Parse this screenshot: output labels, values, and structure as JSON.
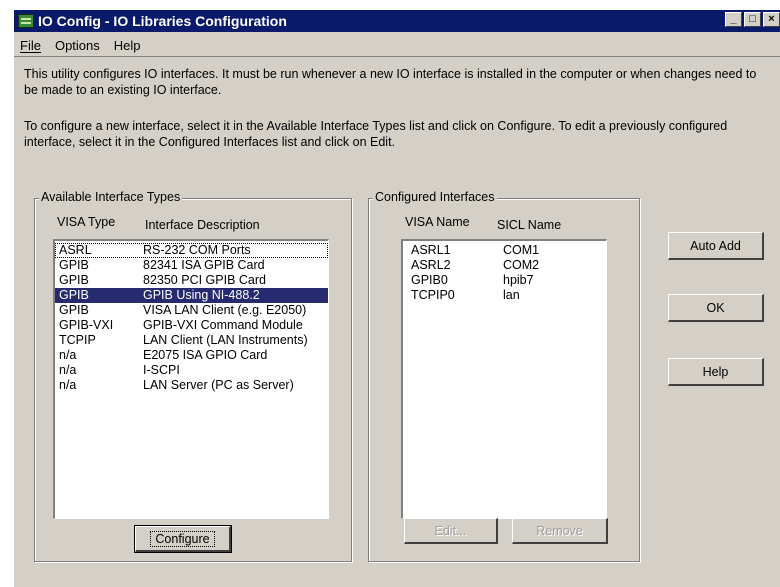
{
  "window": {
    "title": "IO Config - IO Libraries Configuration",
    "controls": [
      "_",
      "□",
      "×"
    ]
  },
  "menu": [
    {
      "label": "File",
      "mnemonic": "F"
    },
    {
      "label": "Options",
      "mnemonic": "O"
    },
    {
      "label": "Help",
      "mnemonic": "H"
    }
  ],
  "intro": {
    "line1": "This utility configures IO interfaces.  It must be run whenever a new IO interface is installed in the computer or when changes need to be made to an existing IO interface.",
    "line2": "To configure a new interface, select it in the Available Interface Types list and click on Configure.  To edit a previously configured interface, select it in the Configured Interfaces list and click on Edit."
  },
  "available": {
    "group_label": "Available Interface Types",
    "col_visa": "VISA Type",
    "col_desc": "Interface Description",
    "rows": [
      {
        "type": "ASRL",
        "desc": "RS-232 COM Ports"
      },
      {
        "type": "GPIB",
        "desc": "82341 ISA GPIB Card"
      },
      {
        "type": "GPIB",
        "desc": "82350 PCI GPIB Card"
      },
      {
        "type": "GPIB",
        "desc": "GPIB Using NI-488.2"
      },
      {
        "type": "GPIB",
        "desc": "VISA LAN Client (e.g. E2050)"
      },
      {
        "type": "GPIB-VXI",
        "desc": "GPIB-VXI Command Module"
      },
      {
        "type": "TCPIP",
        "desc": "LAN Client (LAN Instruments)"
      },
      {
        "type": "n/a",
        "desc": "E2075 ISA GPIO Card"
      },
      {
        "type": "n/a",
        "desc": "I-SCPI"
      },
      {
        "type": "n/a",
        "desc": "LAN Server (PC as Server)"
      }
    ],
    "selected_index": 3,
    "configure_label": "Configure"
  },
  "configured": {
    "group_label": "Configured Interfaces",
    "col_visa": "VISA Name",
    "col_sicl": "SICL Name",
    "rows": [
      {
        "visa": "ASRL1",
        "sicl": "COM1"
      },
      {
        "visa": "ASRL2",
        "sicl": "COM2"
      },
      {
        "visa": "GPIB0",
        "sicl": "hpib7"
      },
      {
        "visa": "TCPIP0",
        "sicl": "lan"
      }
    ],
    "edit_label": "Edit...",
    "remove_label": "Remove"
  },
  "side_buttons": {
    "auto_add": "Auto Add",
    "ok": "OK",
    "help": "Help"
  }
}
